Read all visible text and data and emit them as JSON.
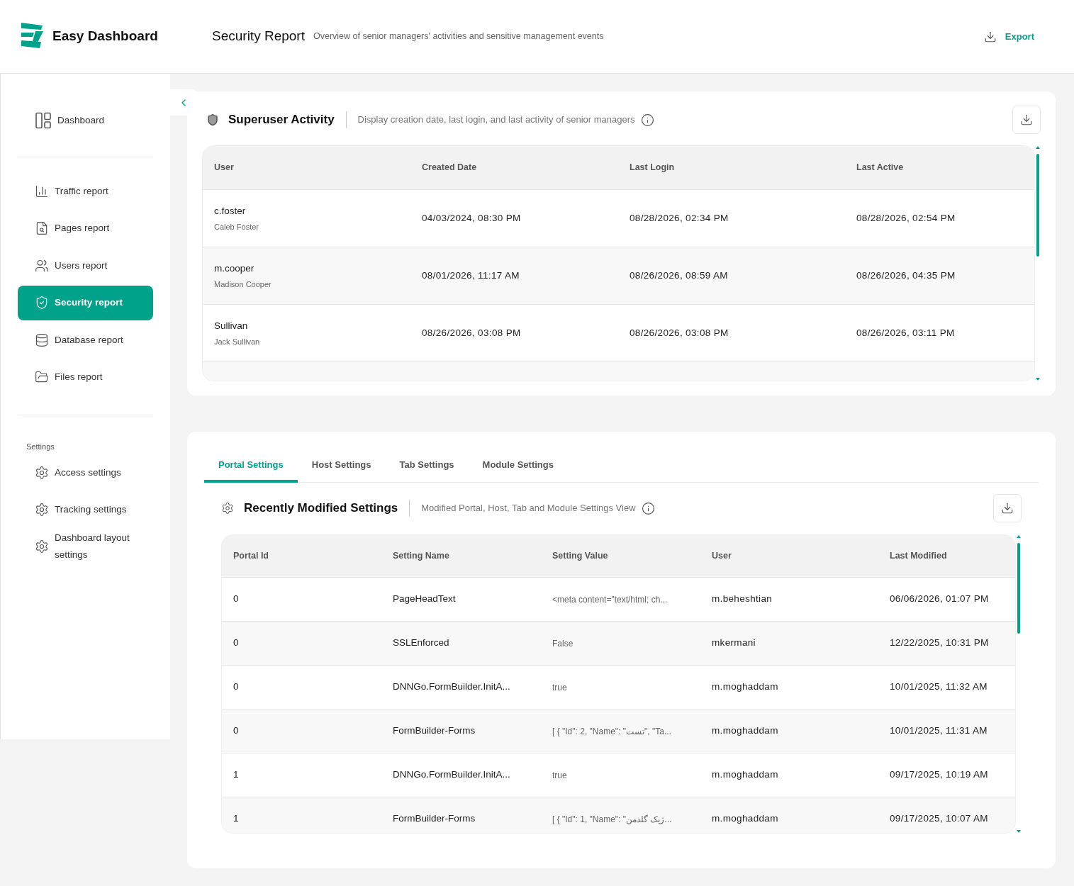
{
  "brand": {
    "name": "Easy Dashboard"
  },
  "header": {
    "title": "Security Report",
    "subtitle": "Overview of senior managers' activities and sensitive management events",
    "export": "Export"
  },
  "sidebar": {
    "groups": [
      {
        "items": [
          {
            "label": "Dashboard",
            "selected": false
          }
        ]
      },
      {
        "items": [
          {
            "label": "Traffic report",
            "selected": false
          },
          {
            "label": "Pages report",
            "selected": false
          },
          {
            "label": "Users report",
            "selected": false
          },
          {
            "label": "Security report",
            "selected": true
          },
          {
            "label": "Database report",
            "selected": false
          },
          {
            "label": "Files report",
            "selected": false
          }
        ]
      }
    ],
    "settings": {
      "title": "Settings",
      "items": [
        {
          "label": "Access settings",
          "selected": false
        },
        {
          "label": "Tracking settings",
          "selected": false
        },
        {
          "label": "Dashboard layout settings",
          "selected": false
        }
      ]
    }
  },
  "superuser": {
    "title": "Superuser Activity",
    "description": "Display creation date, last login, and last activity of senior managers",
    "columns": [
      "User",
      "Created Date",
      "Last Login",
      "Last Active"
    ],
    "rows": [
      {
        "user": "c.foster",
        "name": "Caleb Foster",
        "created": "04/03/2024, 08:30 PM",
        "last_login": "08/28/2026, 02:34 PM",
        "last_active": "08/28/2026, 02:54 PM"
      },
      {
        "user": "m.cooper",
        "name": "Madison Cooper",
        "created": "08/01/2026, 11:17 AM",
        "last_login": "08/26/2026, 08:59 AM",
        "last_active": "08/26/2026, 04:35 PM"
      },
      {
        "user": "Sullivan",
        "name": "Jack Sullivan",
        "created": "08/26/2026, 03:08 PM",
        "last_login": "08/26/2026, 03:08 PM",
        "last_active": "08/26/2026, 03:11 PM"
      }
    ]
  },
  "settings_panel": {
    "tabs": [
      {
        "label": "Portal Settings",
        "selected": true
      },
      {
        "label": "Host Settings",
        "selected": false
      },
      {
        "label": "Tab Settings",
        "selected": false
      },
      {
        "label": "Module Settings",
        "selected": false
      }
    ],
    "title": "Recently Modified Settings",
    "description": "Modified Portal, Host, Tab and Module Settings View",
    "columns": [
      "Portal Id",
      "Setting Name",
      "Setting Value",
      "User",
      "Last Modified"
    ],
    "rows": [
      {
        "portal_id": "0",
        "setting_name": "PageHeadText",
        "setting_value": "<meta content=\"text/html; ch...",
        "user": "m.beheshtian",
        "last_modified": "06/06/2026, 01:07 PM"
      },
      {
        "portal_id": "0",
        "setting_name": "SSLEnforced",
        "setting_value": "False",
        "user": "mkermani",
        "last_modified": "12/22/2025, 10:31 PM"
      },
      {
        "portal_id": "0",
        "setting_name": "DNNGo.FormBuilder.InitA...",
        "setting_value": "true",
        "user": "m.moghaddam",
        "last_modified": "10/01/2025, 11:32 AM"
      },
      {
        "portal_id": "0",
        "setting_name": "FormBuilder-Forms",
        "setting_value": "[ { \"Id\": 2, \"Name\": \"تست\", \"Ta...",
        "user": "m.moghaddam",
        "last_modified": "10/01/2025, 11:31 AM"
      },
      {
        "portal_id": "1",
        "setting_name": "DNNGo.FormBuilder.InitA...",
        "setting_value": "true",
        "user": "m.moghaddam",
        "last_modified": "09/17/2025, 10:19 AM"
      },
      {
        "portal_id": "1",
        "setting_name": "FormBuilder-Forms",
        "setting_value": "[ { \"Id\": 1, \"Name\": \"ژیک گلدمن...",
        "user": "m.moghaddam",
        "last_modified": "09/17/2025, 10:07 AM"
      }
    ]
  }
}
